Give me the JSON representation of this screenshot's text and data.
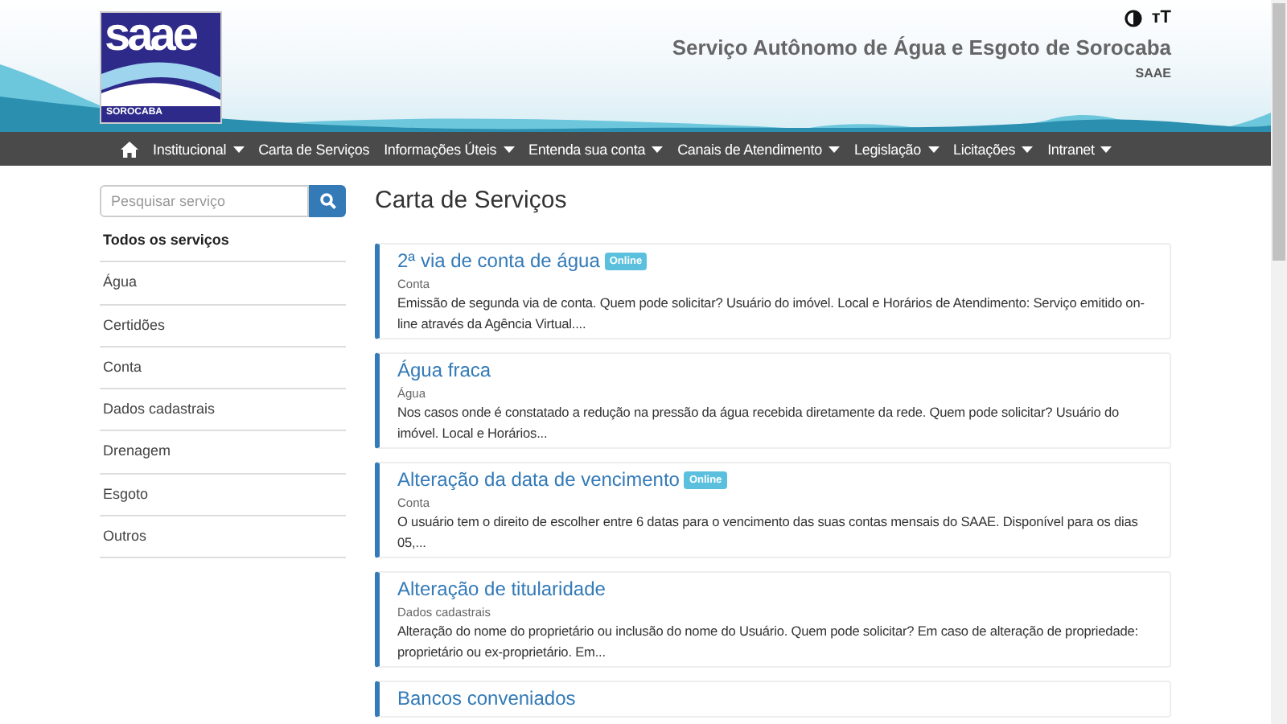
{
  "header": {
    "logo_text": "saae",
    "logo_subtext": "SOROCABA",
    "title": "Serviço Autônomo de Água e Esgoto de Sorocaba",
    "subtitle": "SAAE",
    "font_size_label": "ᴛT"
  },
  "nav": [
    {
      "label": "Institucional",
      "has_menu": true
    },
    {
      "label": "Carta de Serviços",
      "has_menu": false
    },
    {
      "label": "Informações Úteis",
      "has_menu": true
    },
    {
      "label": "Entenda sua conta",
      "has_menu": true
    },
    {
      "label": "Canais de Atendimento",
      "has_menu": true
    },
    {
      "label": "Legislação",
      "has_menu": true
    },
    {
      "label": "Licitações",
      "has_menu": true
    },
    {
      "label": "Intranet",
      "has_menu": true
    }
  ],
  "sidebar": {
    "search": {
      "placeholder": "Pesquisar serviço"
    },
    "categories": [
      {
        "label": "Todos os serviços",
        "selected": true
      },
      {
        "label": "Água",
        "selected": false
      },
      {
        "label": "Certidões",
        "selected": false
      },
      {
        "label": "Conta",
        "selected": false
      },
      {
        "label": "Dados cadastrais",
        "selected": false
      },
      {
        "label": "Drenagem",
        "selected": false
      },
      {
        "label": "Esgoto",
        "selected": false
      },
      {
        "label": "Outros",
        "selected": false
      }
    ]
  },
  "page_title": "Carta de Serviços",
  "services": [
    {
      "title": "2ª via de conta de água",
      "online": true,
      "badge": "Online",
      "category": "Conta",
      "description": "Emissão de segunda via de conta. Quem pode solicitar? Usuário do imóvel. Local e Horários de Atendimento: Serviço emitido on-line através da Agência Virtual...."
    },
    {
      "title": "Água fraca",
      "online": false,
      "category": "Água",
      "description": "Nos casos onde é constatado a redução na pressão da água recebida diretamente da rede. Quem pode solicitar? Usuário do imóvel. Local e Horários..."
    },
    {
      "title": "Alteração da data de vencimento",
      "online": true,
      "badge": "Online",
      "category": "Conta",
      "description": "O usuário tem o direito de escolher entre 6 datas para o vencimento das suas contas mensais do SAAE. Disponível para os dias 05,..."
    },
    {
      "title": "Alteração de titularidade",
      "online": false,
      "category": "Dados cadastrais",
      "description": "Alteração do nome do proprietário ou inclusão do nome do Usuário. Quem pode solicitar? Em caso de alteração de propriedade: proprietário ou ex-proprietário. Em..."
    },
    {
      "title": "Bancos conveniados",
      "online": false
    }
  ]
}
